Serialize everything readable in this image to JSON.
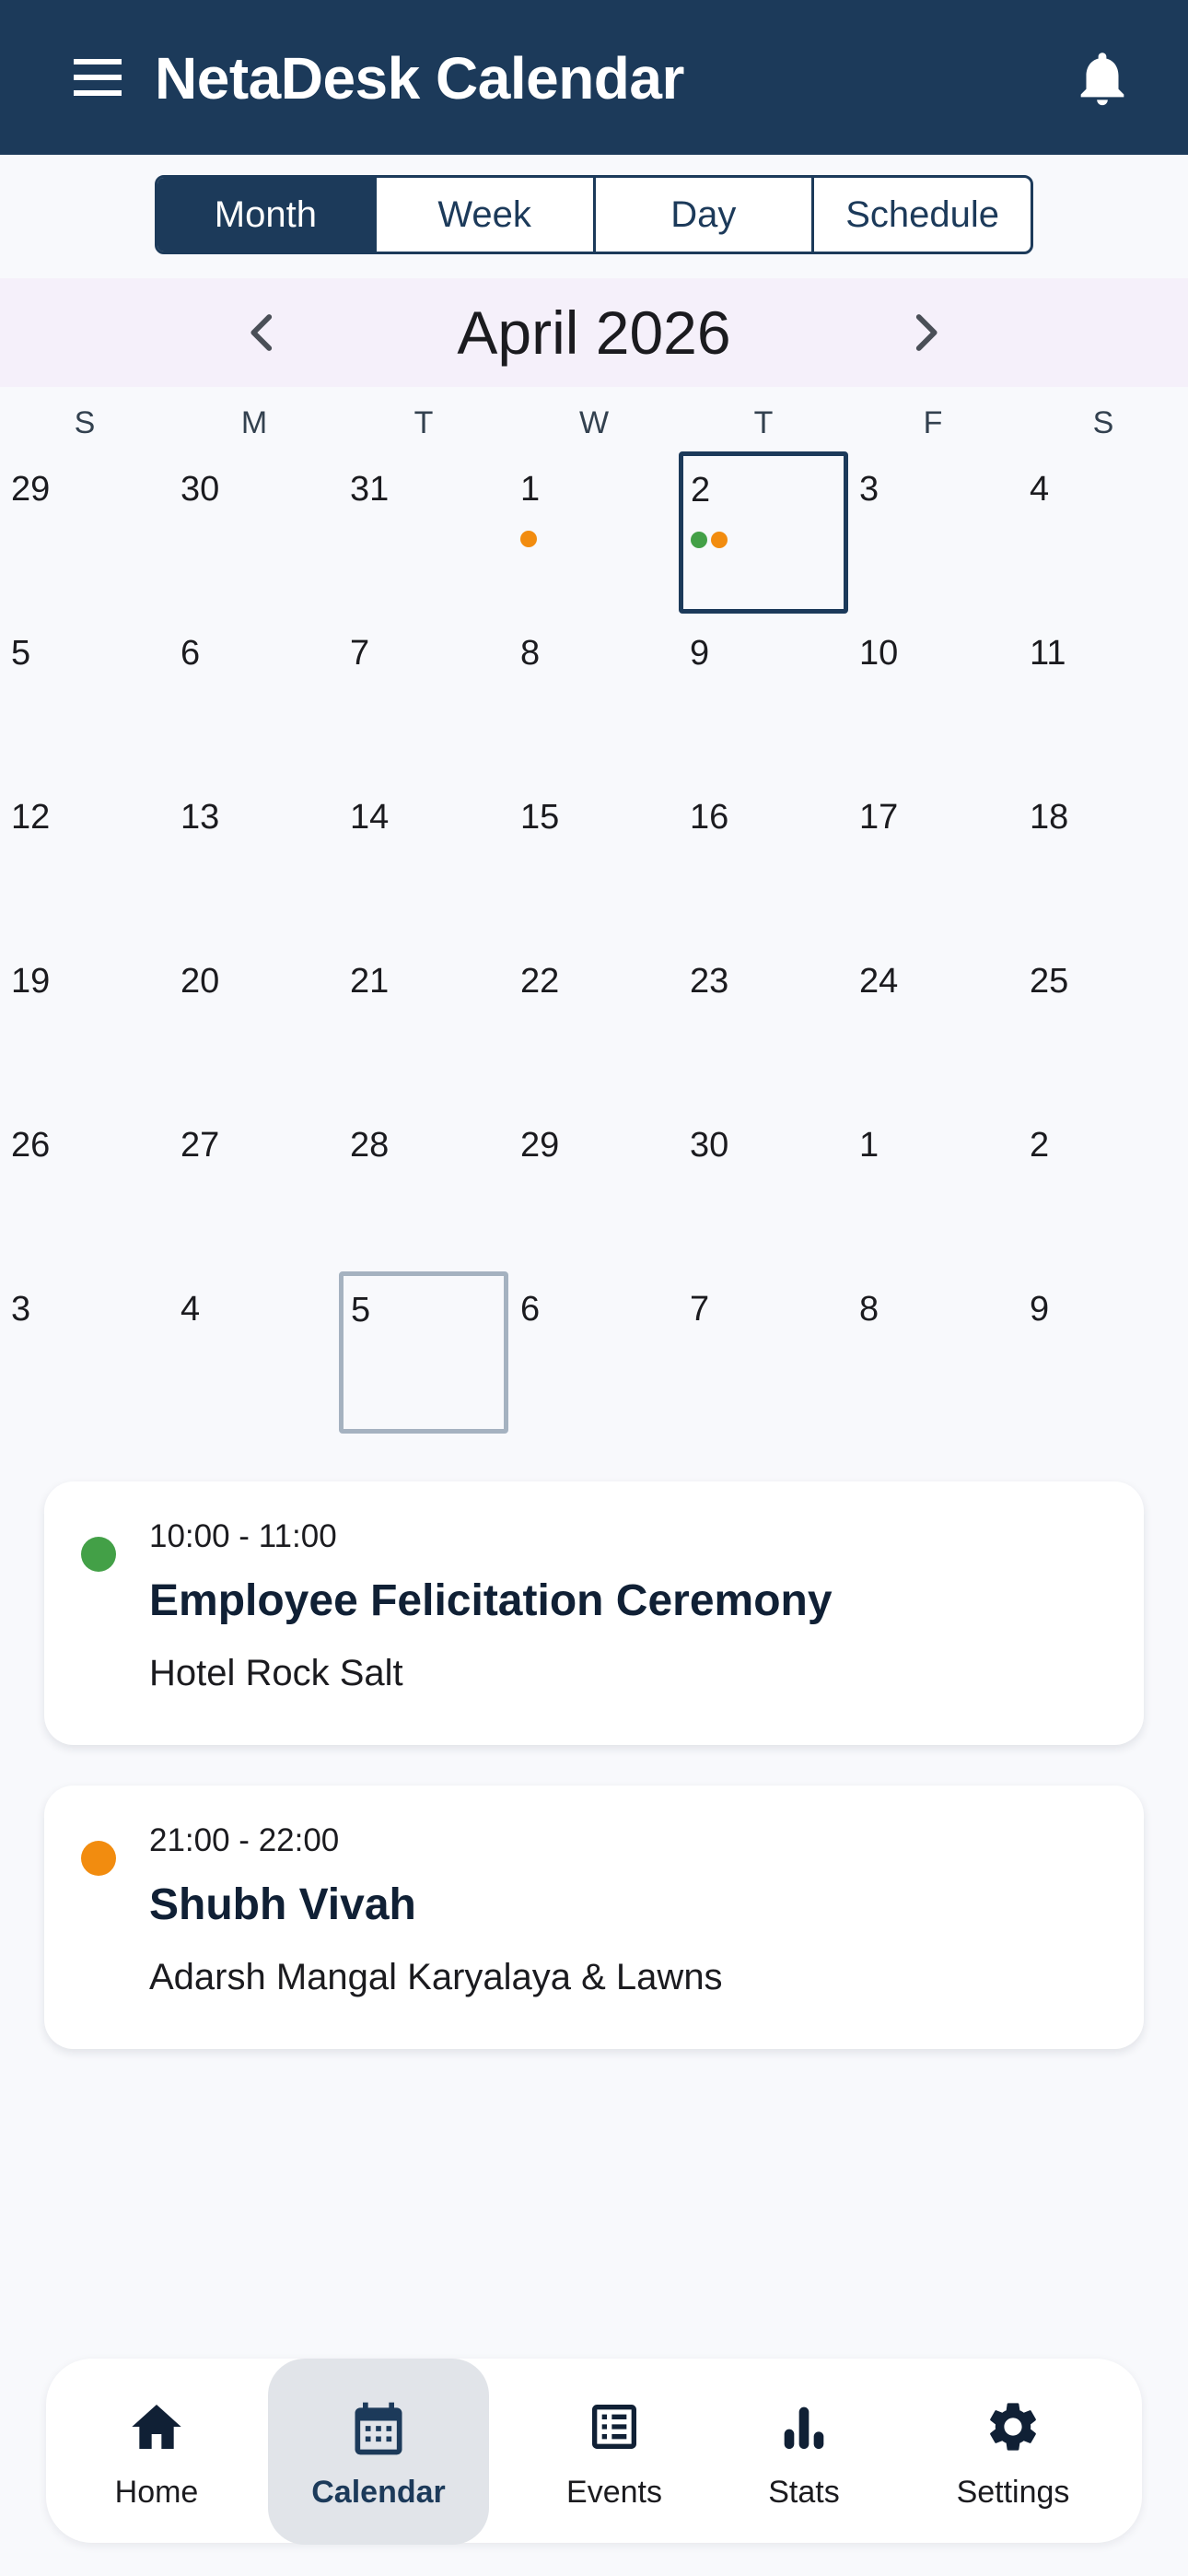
{
  "app_bar": {
    "title": "NetaDesk Calendar",
    "menu_icon": "hamburger-menu-icon",
    "notification_icon": "bell-icon"
  },
  "view_switcher": {
    "tabs": [
      {
        "label": "Month",
        "active": true
      },
      {
        "label": "Week",
        "active": false
      },
      {
        "label": "Day",
        "active": false
      },
      {
        "label": "Schedule",
        "active": false
      }
    ]
  },
  "month_nav": {
    "title": "April 2026",
    "prev_icon": "chevron-left-icon",
    "next_icon": "chevron-right-icon"
  },
  "weekdays": [
    "S",
    "M",
    "T",
    "W",
    "T",
    "F",
    "S"
  ],
  "weeks": [
    [
      {
        "day": "29"
      },
      {
        "day": "30"
      },
      {
        "day": "31"
      },
      {
        "day": "1",
        "dots": [
          "#f28c0f"
        ]
      },
      {
        "day": "2",
        "selected": true,
        "dots": [
          "#43a047",
          "#f28c0f"
        ]
      },
      {
        "day": "3"
      },
      {
        "day": "4"
      }
    ],
    [
      {
        "day": "5"
      },
      {
        "day": "6"
      },
      {
        "day": "7"
      },
      {
        "day": "8"
      },
      {
        "day": "9"
      },
      {
        "day": "10"
      },
      {
        "day": "11"
      }
    ],
    [
      {
        "day": "12"
      },
      {
        "day": "13"
      },
      {
        "day": "14"
      },
      {
        "day": "15"
      },
      {
        "day": "16"
      },
      {
        "day": "17"
      },
      {
        "day": "18"
      }
    ],
    [
      {
        "day": "19"
      },
      {
        "day": "20"
      },
      {
        "day": "21"
      },
      {
        "day": "22"
      },
      {
        "day": "23"
      },
      {
        "day": "24"
      },
      {
        "day": "25"
      }
    ],
    [
      {
        "day": "26"
      },
      {
        "day": "27"
      },
      {
        "day": "28"
      },
      {
        "day": "29"
      },
      {
        "day": "30"
      },
      {
        "day": "1"
      },
      {
        "day": "2"
      }
    ],
    [
      {
        "day": "3"
      },
      {
        "day": "4"
      },
      {
        "day": "5",
        "today": true
      },
      {
        "day": "6"
      },
      {
        "day": "7"
      },
      {
        "day": "8"
      },
      {
        "day": "9"
      }
    ]
  ],
  "events": [
    {
      "time": "10:00 - 11:00",
      "title": "Employee Felicitation Ceremony",
      "location": "Hotel Rock Salt",
      "color": "#43a047"
    },
    {
      "time": "21:00 - 22:00",
      "title": "Shubh Vivah",
      "location": "Adarsh Mangal Karyalaya & Lawns",
      "color": "#f28c0f"
    }
  ],
  "bottom_nav": {
    "items": [
      {
        "label": "Home",
        "icon": "home-icon",
        "active": false
      },
      {
        "label": "Calendar",
        "icon": "calendar-icon",
        "active": true
      },
      {
        "label": "Events",
        "icon": "list-icon",
        "active": false
      },
      {
        "label": "Stats",
        "icon": "bar-chart-icon",
        "active": false
      },
      {
        "label": "Settings",
        "icon": "gear-icon",
        "active": false
      }
    ]
  },
  "colors": {
    "primary": "#1c3a5a",
    "month_bar_bg": "#f5f0fa",
    "event_green": "#43a047",
    "event_orange": "#f28c0f"
  }
}
